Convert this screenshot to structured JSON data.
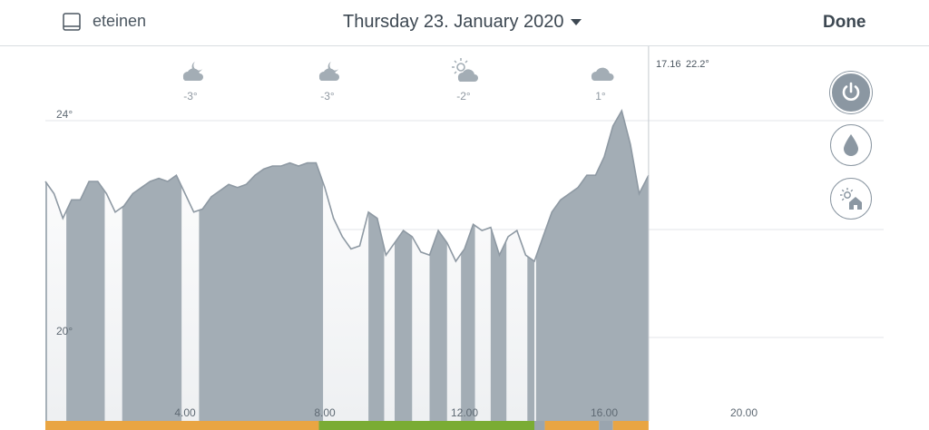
{
  "header": {
    "room_label": "eteinen",
    "date_label": "Thursday 23. January 2020",
    "done_label": "Done"
  },
  "cursor": {
    "time": "17.16",
    "temp": "22.2°"
  },
  "weather": [
    {
      "icon": "cloud-moon-icon",
      "temp": "-3°"
    },
    {
      "icon": "cloud-moon-icon",
      "temp": "-3°"
    },
    {
      "icon": "sun-cloud-icon",
      "temp": "-2°"
    },
    {
      "icon": "cloud-icon",
      "temp": "1°"
    }
  ],
  "colors": {
    "series_fill": "#a3adb5",
    "series_line": "#8e99a3",
    "band_orange": "#e9a543",
    "band_green": "#7aac34",
    "band_grey": "#9aa5af"
  },
  "chart_data": {
    "type": "area",
    "y_ticks": [
      "24°",
      "20°"
    ],
    "x_ticks": [
      {
        "label": "4.00",
        "hour": 4
      },
      {
        "label": "8.00",
        "hour": 8
      },
      {
        "label": "12.00",
        "hour": 12
      },
      {
        "label": "16.00",
        "hour": 16
      },
      {
        "label": "20.00",
        "hour": 20
      }
    ],
    "ylim": [
      18.2,
      24.3
    ],
    "xlim": [
      0,
      24
    ],
    "cursor_hour": 17.27,
    "temperature": [
      [
        0.0,
        22.1
      ],
      [
        0.25,
        21.9
      ],
      [
        0.5,
        21.5
      ],
      [
        0.75,
        21.8
      ],
      [
        1.0,
        21.8
      ],
      [
        1.25,
        22.1
      ],
      [
        1.5,
        22.1
      ],
      [
        1.75,
        21.9
      ],
      [
        2.0,
        21.6
      ],
      [
        2.25,
        21.7
      ],
      [
        2.5,
        21.9
      ],
      [
        2.75,
        22.0
      ],
      [
        3.0,
        22.1
      ],
      [
        3.25,
        22.15
      ],
      [
        3.5,
        22.1
      ],
      [
        3.75,
        22.2
      ],
      [
        4.0,
        21.9
      ],
      [
        4.25,
        21.6
      ],
      [
        4.5,
        21.65
      ],
      [
        4.75,
        21.85
      ],
      [
        5.0,
        21.95
      ],
      [
        5.25,
        22.05
      ],
      [
        5.5,
        22.0
      ],
      [
        5.75,
        22.05
      ],
      [
        6.0,
        22.2
      ],
      [
        6.25,
        22.3
      ],
      [
        6.5,
        22.35
      ],
      [
        6.75,
        22.35
      ],
      [
        7.0,
        22.4
      ],
      [
        7.25,
        22.35
      ],
      [
        7.5,
        22.4
      ],
      [
        7.75,
        22.4
      ],
      [
        8.0,
        22.0
      ],
      [
        8.25,
        21.5
      ],
      [
        8.5,
        21.2
      ],
      [
        8.75,
        21.0
      ],
      [
        9.0,
        21.05
      ],
      [
        9.25,
        21.6
      ],
      [
        9.5,
        21.5
      ],
      [
        9.75,
        20.9
      ],
      [
        10.0,
        21.1
      ],
      [
        10.25,
        21.3
      ],
      [
        10.5,
        21.2
      ],
      [
        10.75,
        20.95
      ],
      [
        11.0,
        20.9
      ],
      [
        11.25,
        21.3
      ],
      [
        11.5,
        21.1
      ],
      [
        11.75,
        20.8
      ],
      [
        12.0,
        21.0
      ],
      [
        12.25,
        21.4
      ],
      [
        12.5,
        21.3
      ],
      [
        12.75,
        21.35
      ],
      [
        13.0,
        20.9
      ],
      [
        13.25,
        21.2
      ],
      [
        13.5,
        21.3
      ],
      [
        13.75,
        20.9
      ],
      [
        14.0,
        20.8
      ],
      [
        14.25,
        21.2
      ],
      [
        14.5,
        21.6
      ],
      [
        14.75,
        21.8
      ],
      [
        15.0,
        21.9
      ],
      [
        15.25,
        22.0
      ],
      [
        15.5,
        22.2
      ],
      [
        15.75,
        22.2
      ],
      [
        16.0,
        22.5
      ],
      [
        16.25,
        23.0
      ],
      [
        16.5,
        23.25
      ],
      [
        16.75,
        22.7
      ],
      [
        17.0,
        21.9
      ],
      [
        17.27,
        22.2
      ]
    ],
    "heating_intervals": [
      [
        0.0,
        0.05
      ],
      [
        0.6,
        1.7
      ],
      [
        2.2,
        3.9
      ],
      [
        4.4,
        7.95
      ],
      [
        9.25,
        9.7
      ],
      [
        10.0,
        10.5
      ],
      [
        11.0,
        11.5
      ],
      [
        11.9,
        12.3
      ],
      [
        12.75,
        13.2
      ],
      [
        13.8,
        14.0
      ],
      [
        14.05,
        17.27
      ]
    ],
    "mode_bands": [
      {
        "from": 0.0,
        "to": 7.83,
        "color": "#e9a543"
      },
      {
        "from": 7.83,
        "to": 14.0,
        "color": "#7aac34"
      },
      {
        "from": 14.0,
        "to": 14.3,
        "color": "#9aa5af"
      },
      {
        "from": 14.3,
        "to": 15.85,
        "color": "#e9a543"
      },
      {
        "from": 15.85,
        "to": 16.25,
        "color": "#9aa5af"
      },
      {
        "from": 16.25,
        "to": 17.27,
        "color": "#e9a543"
      }
    ]
  }
}
